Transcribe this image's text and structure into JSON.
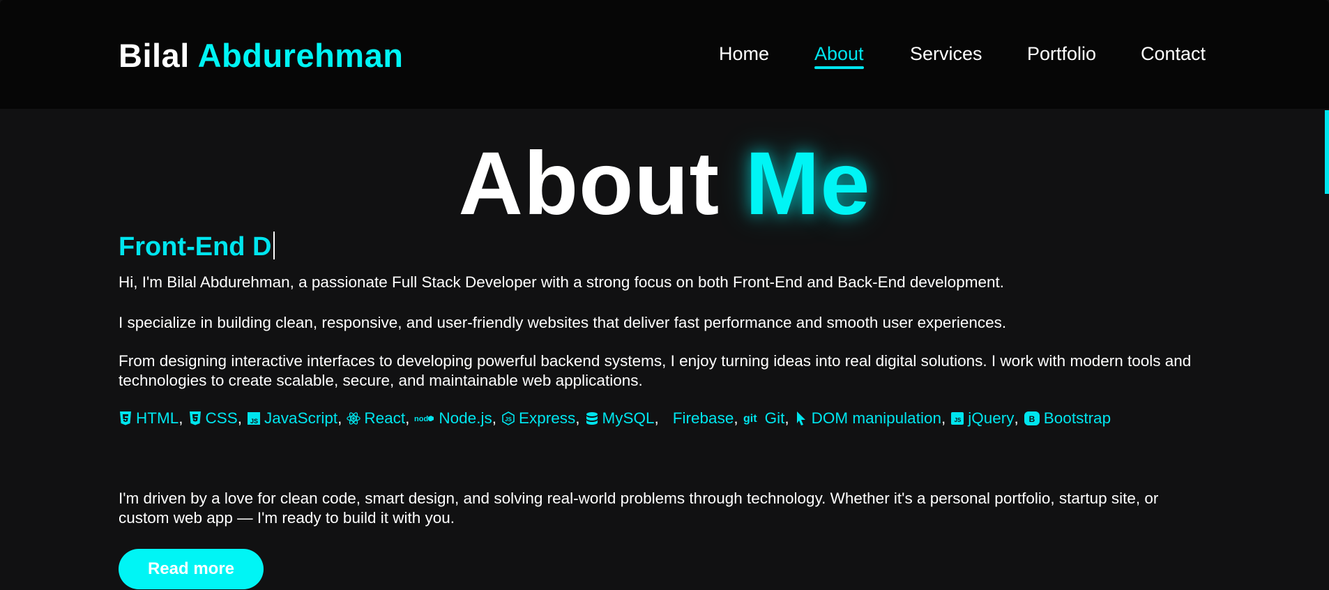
{
  "brand": {
    "first": "Bilal",
    "last": "Abdurehman"
  },
  "nav": [
    {
      "label": "Home"
    },
    {
      "label": "About"
    },
    {
      "label": "Services"
    },
    {
      "label": "Portfolio"
    },
    {
      "label": "Contact"
    }
  ],
  "active_nav": "About",
  "about": {
    "heading_part1": "About",
    "heading_part2": "Me",
    "subtitle": "Front-End D",
    "intro": "Hi, I'm Bilal Abdurehman, a passionate Full Stack Developer with a strong focus on both Front-End and Back-End development.",
    "specialize": "I specialize in building clean, responsive, and user-friendly websites that deliver fast performance and smooth user experiences.",
    "designing": "From designing interactive interfaces to developing powerful backend systems, I enjoy turning ideas into real digital solutions. I work with modern tools and technologies to create scalable, secure, and maintainable web applications.",
    "skills": [
      {
        "label": "HTML",
        "icon": "html5-icon"
      },
      {
        "label": "CSS",
        "icon": "css3-icon"
      },
      {
        "label": "JavaScript",
        "icon": "javascript-icon"
      },
      {
        "label": "React",
        "icon": "react-icon"
      },
      {
        "label": "Node.js",
        "icon": "nodejs-icon"
      },
      {
        "label": "Express",
        "icon": "express-icon"
      },
      {
        "label": "MySQL",
        "icon": "database-icon"
      },
      {
        "label": "Firebase",
        "icon": "firebase-icon"
      },
      {
        "label": "Git",
        "icon": "git-icon"
      },
      {
        "label": "DOM manipulation",
        "icon": "cursor-icon"
      },
      {
        "label": "jQuery",
        "icon": "jquery-icon"
      },
      {
        "label": "Bootstrap",
        "icon": "bootstrap-icon"
      }
    ],
    "closing": "I'm driven by a love for clean code, smart design, and solving real-world problems through technology. Whether it's a personal portfolio, startup site, or custom web app — I'm ready to build it with you.",
    "button": "Read more"
  },
  "colors": {
    "accent": "#00f5f5",
    "background": "#111112",
    "header": "#060606"
  }
}
